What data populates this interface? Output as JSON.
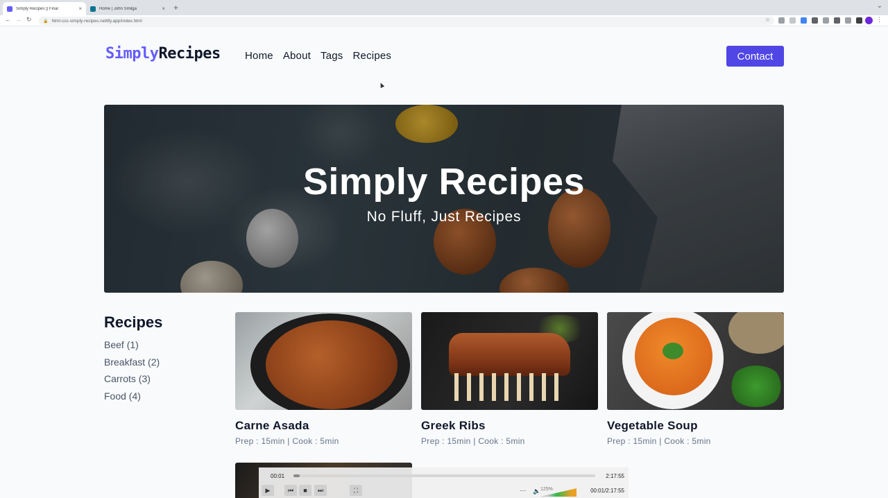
{
  "browser": {
    "tabs": [
      {
        "title": "Simply Recipes || Final",
        "favicon_color": "#645cff",
        "active": true
      },
      {
        "title": "Home | John Smilga",
        "favicon_color": "#0e7490",
        "active": false
      }
    ],
    "close_glyph": "×",
    "new_tab_glyph": "+",
    "url": "html-css-simply-recipes.netlify.app/index.html"
  },
  "site": {
    "logo_part1": "Simply",
    "logo_part2": "Recipes",
    "nav": [
      {
        "label": "Home"
      },
      {
        "label": "About"
      },
      {
        "label": "Tags"
      },
      {
        "label": "Recipes"
      }
    ],
    "contact_label": "Contact",
    "accent_color": "#645cff",
    "button_color": "#4f46e5"
  },
  "hero": {
    "title": "Simply Recipes",
    "subtitle": "No Fluff, Just Recipes"
  },
  "sidebar": {
    "title": "Recipes",
    "tags": [
      {
        "label": "Beef (1)"
      },
      {
        "label": "Breakfast (2)"
      },
      {
        "label": "Carrots (3)"
      },
      {
        "label": "Food (4)"
      }
    ]
  },
  "recipes": [
    {
      "name": "Carne Asada",
      "meta": "Prep : 15min | Cook : 5min",
      "image": "carne-asada-photo"
    },
    {
      "name": "Greek Ribs",
      "meta": "Prep : 15min | Cook : 5min",
      "image": "greek-ribs-photo"
    },
    {
      "name": "Vegetable Soup",
      "meta": "Prep : 15min | Cook : 5min",
      "image": "vegetable-soup-photo"
    }
  ],
  "player": {
    "current": "00:01",
    "total": "2:17:55",
    "volume_label": "125%",
    "progress": 0.0001,
    "both": "00:01/2:17:55",
    "icons": [
      "play-icon",
      "previous-icon",
      "stop-icon",
      "next-icon",
      "fullscreen-icon",
      "playlist-icon",
      "volume-icon"
    ]
  }
}
